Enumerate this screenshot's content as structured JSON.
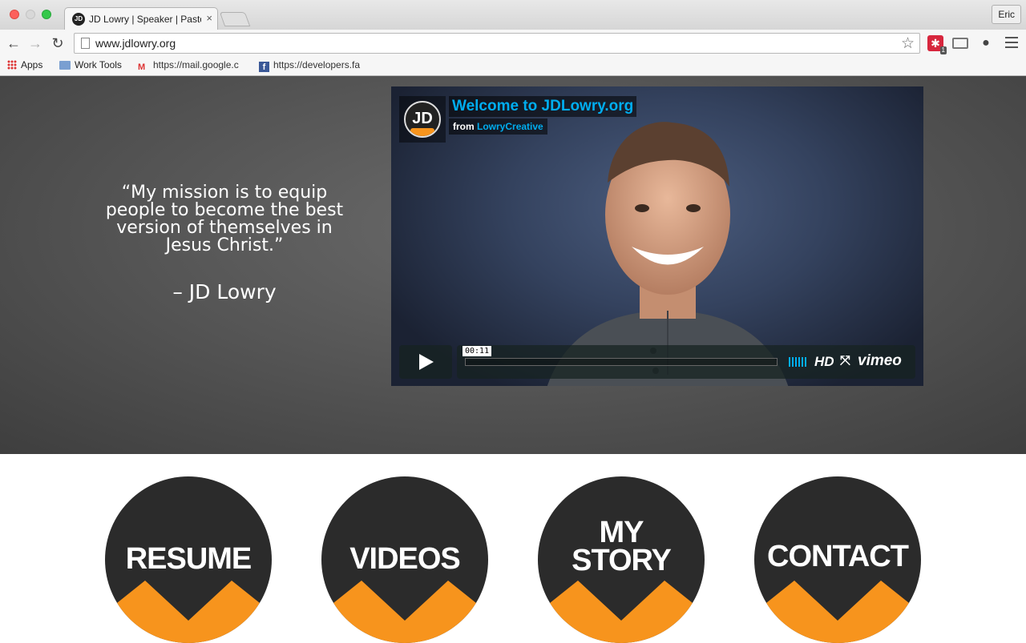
{
  "browser": {
    "tab_title": "JD Lowry | Speaker | Pastor",
    "tab_favicon_text": "JD",
    "profile_name": "Eric",
    "url": "www.jdlowry.org",
    "extension_badge": "1",
    "bookmarks": [
      {
        "label": "Apps",
        "icon": "apps-grid-icon"
      },
      {
        "label": "Work Tools",
        "icon": "folder-icon"
      },
      {
        "label": "https://mail.google.c",
        "icon": "gmail-icon"
      },
      {
        "label": "https://developers.fa",
        "icon": "facebook-icon"
      }
    ]
  },
  "hero": {
    "quote": "“My mission is to equip people to become the best version of themselves in Jesus Christ.”",
    "author": "– JD Lowry"
  },
  "video": {
    "logo_text": "JD",
    "title": "Welcome to JDLowry.org",
    "from_prefix": "from",
    "from_author": "LowryCreative",
    "time": "00:11",
    "progress": 0.0,
    "hd_label": "HD",
    "brand": "vimeo",
    "colors": {
      "accent": "#00adef",
      "controls_bg": "#172322"
    }
  },
  "nav_buttons": [
    {
      "label": "RESUME"
    },
    {
      "label_line1": "MY",
      "label_line2": "STORY"
    },
    {
      "label": "VIDEOS"
    },
    {
      "label": "CONTACT"
    }
  ],
  "colors": {
    "button_bg": "#2b2b2b",
    "chevron": "#f7941d"
  }
}
